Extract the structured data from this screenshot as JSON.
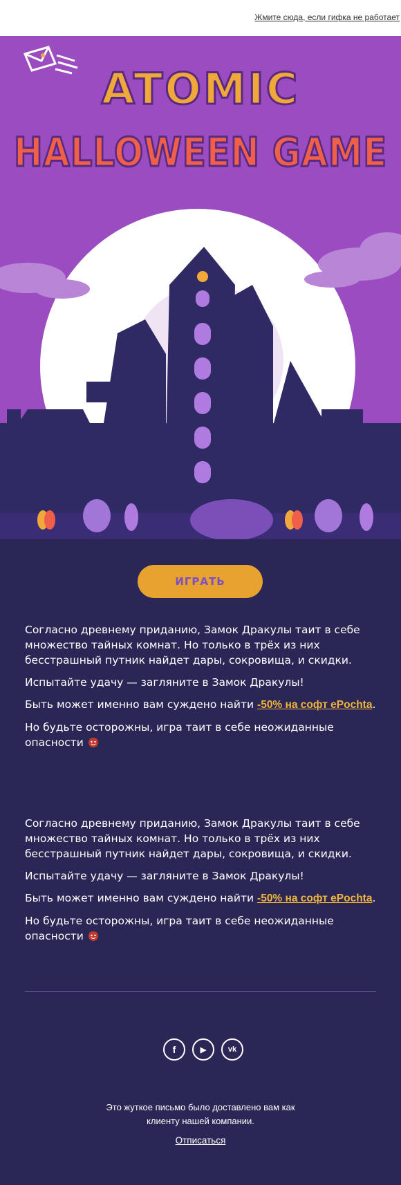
{
  "topbar": {
    "link_text": "Жмите сюда, если гифка не работает"
  },
  "hero": {
    "title_line1": "ATOMIC",
    "title_line2": "HALLOWEEN GAME",
    "colors": {
      "background": "#9a4cc0",
      "title_top": "#f0a83a",
      "title_bottom": "#ef5f4a",
      "castle": "#2f2a63",
      "moon": "#ffffff"
    }
  },
  "main": {
    "play_button": "ИГРАТЬ",
    "block1": {
      "p1": "Согласно древнему приданию, Замок Дракулы таит в себе множество тайных комнат. Но только в трёх из них бесстрашный путник найдет дары, сокровища, и скидки.",
      "p2": "Испытайте удачу — загляните в Замок Дракулы!",
      "p3_prefix": "Быть может именно вам суждено найти ",
      "p3_link": "-50% на софт ePochta",
      "p3_suffix": ".",
      "p4": "Но будьте осторожны, игра таит в себе неожиданные опасности"
    },
    "block2": {
      "p1": "Согласно древнему приданию, Замок Дракулы таит в себе множество тайных комнат. Но только в трёх из них бесстрашный путник найдет дары, сокровища, и скидки.",
      "p2": "Испытайте удачу — загляните в Замок Дракулы!",
      "p3_prefix": "Быть может именно вам суждено найти ",
      "p3_link": "-50% на софт ePochta",
      "p3_suffix": ".",
      "p4": "Но будьте осторожны, игра таит в себе неожиданные опасности"
    }
  },
  "social": {
    "facebook": "f",
    "youtube": "▶",
    "vk": "vk"
  },
  "footer": {
    "line1": "Это жуткое письмо было доставлено вам как",
    "line2": "клиенту нашей компании.",
    "unsubscribe": "Отписаться"
  }
}
